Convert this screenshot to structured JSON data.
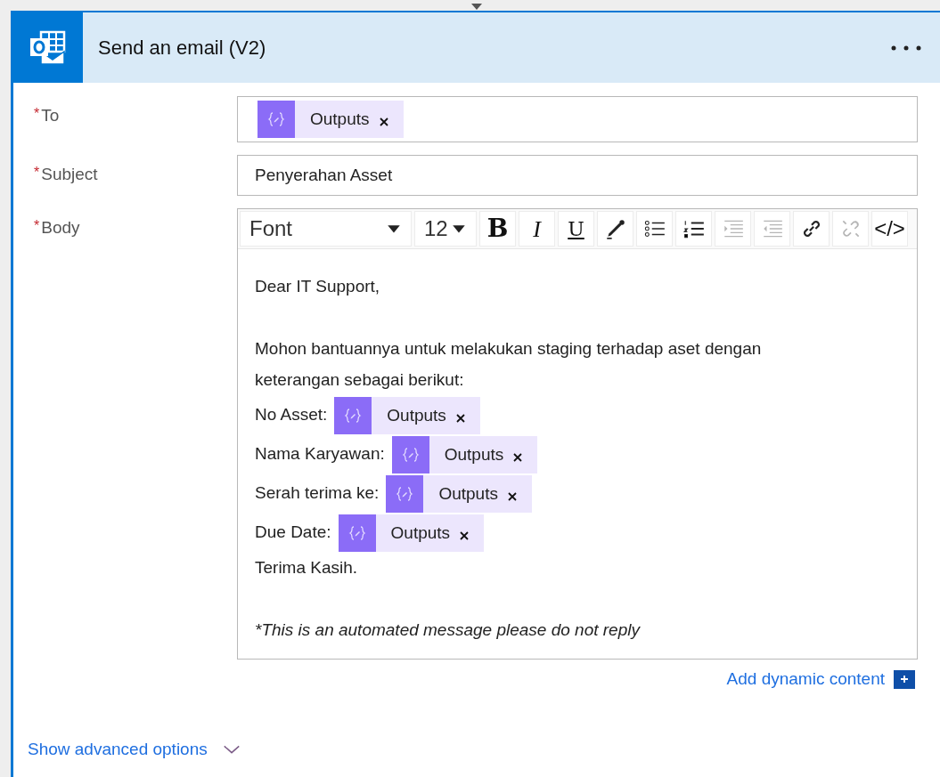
{
  "card": {
    "title": "Send an email (V2)"
  },
  "fields": [
    {
      "kind": "tokens",
      "mark": "*",
      "label": "To",
      "tokens": [
        {
          "label": "Outputs"
        }
      ]
    },
    {
      "kind": "text",
      "mark": "*",
      "label": "Subject",
      "value": "Penyerahan Asset"
    },
    {
      "kind": "editor",
      "mark": "*",
      "label": "Body"
    }
  ],
  "toolbar": {
    "font": "Font",
    "size": "12",
    "buttons": [
      {
        "kind": "bold",
        "label": "B",
        "disabled": false
      },
      {
        "kind": "italic",
        "label": "I",
        "disabled": false
      },
      {
        "kind": "underline",
        "label": "U",
        "disabled": false
      },
      {
        "kind": "color",
        "disabled": false
      },
      {
        "kind": "bullets",
        "disabled": false
      },
      {
        "kind": "numbers",
        "disabled": false
      },
      {
        "kind": "indent",
        "disabled": true
      },
      {
        "kind": "outdent",
        "disabled": true
      },
      {
        "kind": "link",
        "disabled": false
      },
      {
        "kind": "unlink",
        "disabled": true
      },
      {
        "kind": "code",
        "label": "</>",
        "disabled": false
      }
    ]
  },
  "body_lines": [
    {
      "kind": "text",
      "text": "Dear IT Support,"
    },
    {
      "kind": "blank"
    },
    {
      "kind": "text",
      "text": "Mohon bantuannya untuk melakukan staging terhadap aset dengan"
    },
    {
      "kind": "text",
      "text": "keterangan sebagai berikut:"
    },
    {
      "kind": "field",
      "text": "No Asset:",
      "token": "Outputs"
    },
    {
      "kind": "field",
      "text": "Nama Karyawan:",
      "token": "Outputs"
    },
    {
      "kind": "field",
      "text": "Serah terima ke:",
      "token": "Outputs"
    },
    {
      "kind": "field",
      "text": "Due Date:",
      "token": "Outputs"
    },
    {
      "kind": "text",
      "text": "Terima Kasih."
    },
    {
      "kind": "blank"
    },
    {
      "kind": "note",
      "text": "*This is an automated message please do not reply"
    }
  ],
  "dynamic_content": "Add dynamic content",
  "advanced": {
    "label": "Show advanced options",
    "expanded": false
  }
}
